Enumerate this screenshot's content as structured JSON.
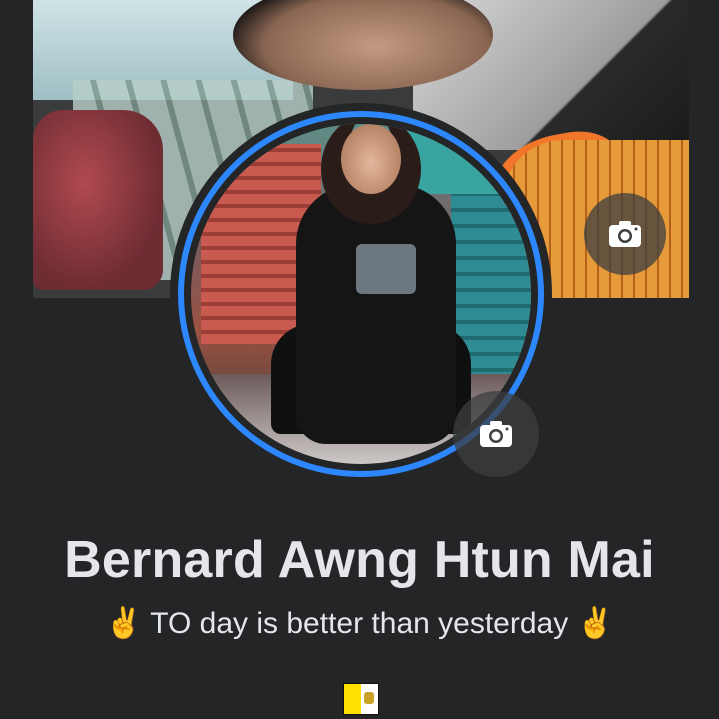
{
  "profile": {
    "name": "Bernard Awng Htun Mai",
    "bio_prefix_emoji": "✌",
    "bio_text": "TO day is better than yesterday",
    "bio_suffix_emoji": "✌",
    "flag_icon": "vatican-flag-icon"
  },
  "icons": {
    "cover_camera": "camera-icon",
    "avatar_camera": "camera-icon"
  },
  "colors": {
    "background": "#242526",
    "story_ring": "#2d88ff",
    "text": "#e4e6eb",
    "camera_button_bg": "#3e4042"
  }
}
